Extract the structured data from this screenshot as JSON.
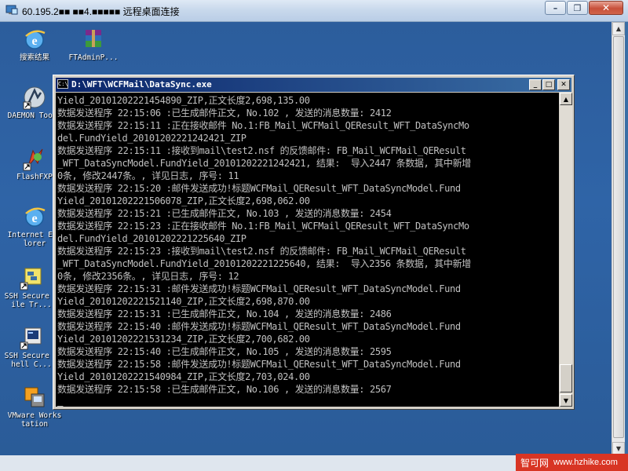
{
  "rdp": {
    "title": "60.195.2■■ ■■4.■■■■■ 远程桌面连接",
    "minimize": "–",
    "restore": "❐",
    "close": "✕"
  },
  "desktop_icons": [
    {
      "label": "搜索结果",
      "icon": "search-results-ie-icon"
    },
    {
      "label": "FTAdminP...",
      "icon": "winrar-archive-icon"
    },
    {
      "label": "DAEMON Tools",
      "icon": "daemon-tools-icon"
    },
    {
      "label": "FlashFXP",
      "icon": "flashfxp-icon"
    },
    {
      "label": "Internet Explorer",
      "icon": "internet-explorer-icon"
    },
    {
      "label": "SSH Secure File Tr...",
      "icon": "ssh-file-transfer-icon"
    },
    {
      "label": "SSH Secure Shell C...",
      "icon": "ssh-shell-client-icon"
    },
    {
      "label": "VMware Workstation",
      "icon": "vmware-workstation-icon"
    }
  ],
  "console": {
    "title": "D:\\WFT\\WCFMail\\DataSync.exe",
    "icon_text": "C:\\",
    "minimize": "_",
    "maximize": "□",
    "close": "✕",
    "lines": [
      "Yield_20101202221454890_ZIP,正文长度2,698,135.00",
      "数据发送程序 22:15:06 :已生成邮件正文, No.102 , 发送的消息数量: 2412",
      "数据发送程序 22:15:11 :正在接收邮件 No.1:FB_Mail_WCFMail_QEResult_WFT_DataSyncMo",
      "del.FundYield_20101202221242421_ZIP",
      "数据发送程序 22:15:11 :接收到mail\\test2.nsf 的反馈邮件: FB_Mail_WCFMail_QEResult",
      "_WFT_DataSyncModel.FundYield_20101202221242421, 结果:  导入2447 条数据, 其中新增",
      "0条, 修改2447条。, 详见日志, 序号: 11",
      "数据发送程序 22:15:20 :邮件发送成功!标题WCFMail_QEResult_WFT_DataSyncModel.Fund",
      "Yield_20101202221506078_ZIP,正文长度2,698,062.00",
      "数据发送程序 22:15:21 :已生成邮件正文, No.103 , 发送的消息数量: 2454",
      "数据发送程序 22:15:23 :正在接收邮件 No.1:FB_Mail_WCFMail_QEResult_WFT_DataSyncMo",
      "del.FundYield_20101202221225640_ZIP",
      "数据发送程序 22:15:23 :接收到mail\\test2.nsf 的反馈邮件: FB_Mail_WCFMail_QEResult",
      "_WFT_DataSyncModel.FundYield_20101202221225640, 结果:  导入2356 条数据, 其中新增",
      "0条, 修改2356条。, 详见日志, 序号: 12",
      "数据发送程序 22:15:31 :邮件发送成功!标题WCFMail_QEResult_WFT_DataSyncModel.Fund",
      "Yield_20101202221521140_ZIP,正文长度2,698,870.00",
      "数据发送程序 22:15:31 :已生成邮件正文, No.104 , 发送的消息数量: 2486",
      "数据发送程序 22:15:40 :邮件发送成功!标题WCFMail_QEResult_WFT_DataSyncModel.Fund",
      "Yield_20101202221531234_ZIP,正文长度2,700,682.00",
      "数据发送程序 22:15:40 :已生成邮件正文, No.105 , 发送的消息数量: 2595",
      "数据发送程序 22:15:58 :邮件发送成功!标题WCFMail_QEResult_WFT_DataSyncModel.Fund",
      "Yield_20101202221540984_ZIP,正文长度2,703,024.00",
      "数据发送程序 22:15:58 :已生成邮件正文, No.106 , 发送的消息数量: 2567"
    ],
    "cursor": "▁"
  },
  "watermark": {
    "brand": "智可网",
    "site": "www.hzhike.com"
  }
}
